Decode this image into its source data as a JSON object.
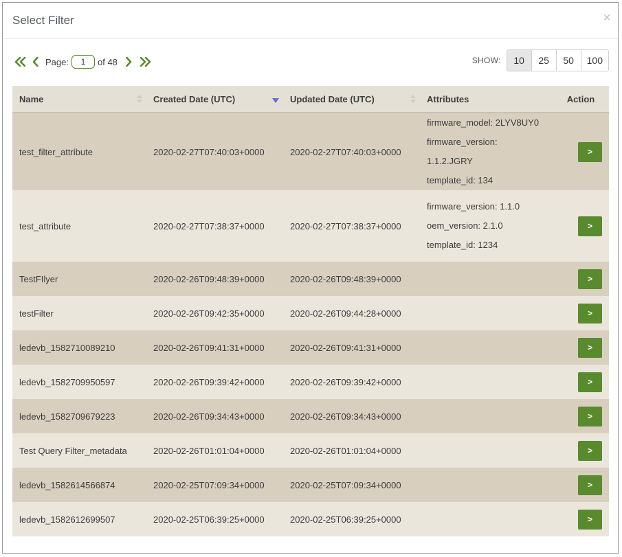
{
  "modal": {
    "title": "Select Filter",
    "close_symbol": "×"
  },
  "pager": {
    "page_label": "Page:",
    "current_page": "1",
    "of_text": "of 48"
  },
  "show": {
    "label": "SHOW:",
    "options": [
      "10",
      "25",
      "50",
      "100"
    ],
    "selected": "10"
  },
  "table": {
    "headers": {
      "name": "Name",
      "created": "Created Date (UTC)",
      "updated": "Updated Date (UTC)",
      "attributes": "Attributes",
      "action": "Action"
    },
    "sorted_column": "created",
    "sort_direction": "descending",
    "action_label": ">",
    "rows": [
      {
        "name": "test_filter_attribute",
        "created": "2020-02-27T07:40:03+0000",
        "updated": "2020-02-27T07:40:03+0000",
        "attributes": [
          "firmware_model: 2LYV8UY0",
          "firmware_version: 1.1.2.JGRY",
          "template_id: 134"
        ]
      },
      {
        "name": "test_attribute",
        "created": "2020-02-27T07:38:37+0000",
        "updated": "2020-02-27T07:38:37+0000",
        "attributes": [
          "firmware_version: 1.1.0",
          "oem_version: 2.1.0",
          "template_id: 1234"
        ]
      },
      {
        "name": "TestFIlyer",
        "created": "2020-02-26T09:48:39+0000",
        "updated": "2020-02-26T09:48:39+0000",
        "attributes": []
      },
      {
        "name": "testFilter",
        "created": "2020-02-26T09:42:35+0000",
        "updated": "2020-02-26T09:44:28+0000",
        "attributes": []
      },
      {
        "name": "ledevb_1582710089210",
        "created": "2020-02-26T09:41:31+0000",
        "updated": "2020-02-26T09:41:31+0000",
        "attributes": []
      },
      {
        "name": "ledevb_1582709950597",
        "created": "2020-02-26T09:39:42+0000",
        "updated": "2020-02-26T09:39:42+0000",
        "attributes": []
      },
      {
        "name": "ledevb_1582709679223",
        "created": "2020-02-26T09:34:43+0000",
        "updated": "2020-02-26T09:34:43+0000",
        "attributes": []
      },
      {
        "name": "Test Query Filter_metadata",
        "created": "2020-02-26T01:01:04+0000",
        "updated": "2020-02-26T01:01:04+0000",
        "attributes": []
      },
      {
        "name": "ledevb_1582614566874",
        "created": "2020-02-25T07:09:34+0000",
        "updated": "2020-02-25T07:09:34+0000",
        "attributes": []
      },
      {
        "name": "ledevb_1582612699507",
        "created": "2020-02-25T06:39:25+0000",
        "updated": "2020-02-25T06:39:25+0000",
        "attributes": []
      }
    ]
  },
  "colors": {
    "accent": "#5a8a2e",
    "row_odd": "#d8cfbf",
    "row_even": "#ebe6dc",
    "header_bg": "#e5e0d6"
  }
}
